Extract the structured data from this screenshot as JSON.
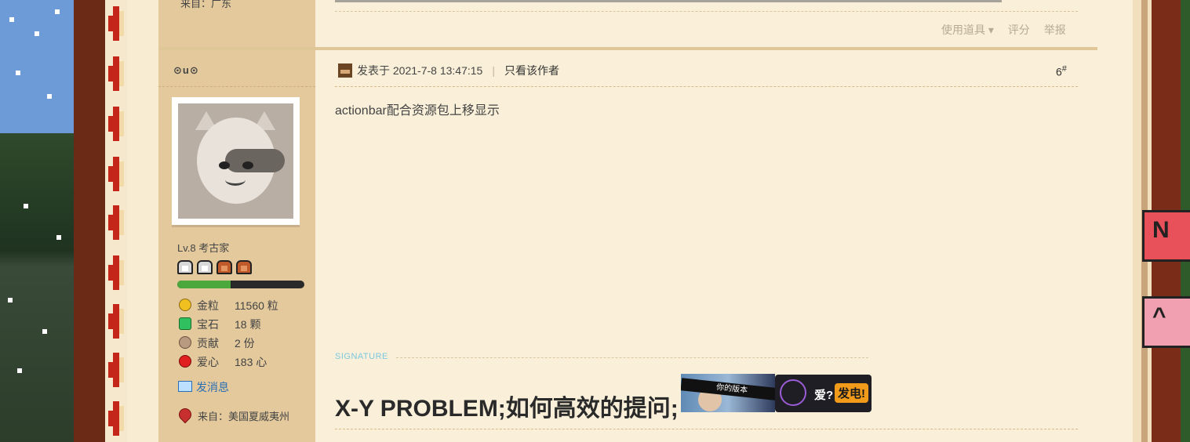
{
  "prev_post": {
    "from_label": "来自：广东",
    "actions": [
      "使用道具 ▾",
      "评分",
      "举报"
    ]
  },
  "author": {
    "username": "⊙u⊙",
    "level": "Lv.8 考古家",
    "xp_fraction": 0.42,
    "stats": [
      {
        "icon": "gold-nugget-icon",
        "label": "金粒",
        "value": "11560 粒"
      },
      {
        "icon": "gem-icon",
        "label": "宝石",
        "value": "18 颗"
      },
      {
        "icon": "contribution-icon",
        "label": "贡献",
        "value": "2 份"
      },
      {
        "icon": "apple-heart-icon",
        "label": "爱心",
        "value": "183 心"
      }
    ],
    "send_message": "发消息",
    "from": "来自：美国夏威夷州"
  },
  "post": {
    "posted_label": "发表于 2021-7-8 13:47:15",
    "separator": "|",
    "only_author": "只看该作者",
    "floor": "6",
    "floor_sup": "#",
    "content": "actionbar配合资源包上移显示"
  },
  "signature": {
    "label": "SIGNATURE",
    "text": "X-Y PROBLEM;如何高效的提问;",
    "img1_text": "你的版本",
    "img2_text1": "爱?",
    "img2_text2": "发电!"
  },
  "colors": {
    "sidebar_bg": "#e3c99c",
    "post_bg": "#faf0d9",
    "link": "#2a6fb5",
    "signature_label": "#7cc7e0"
  }
}
